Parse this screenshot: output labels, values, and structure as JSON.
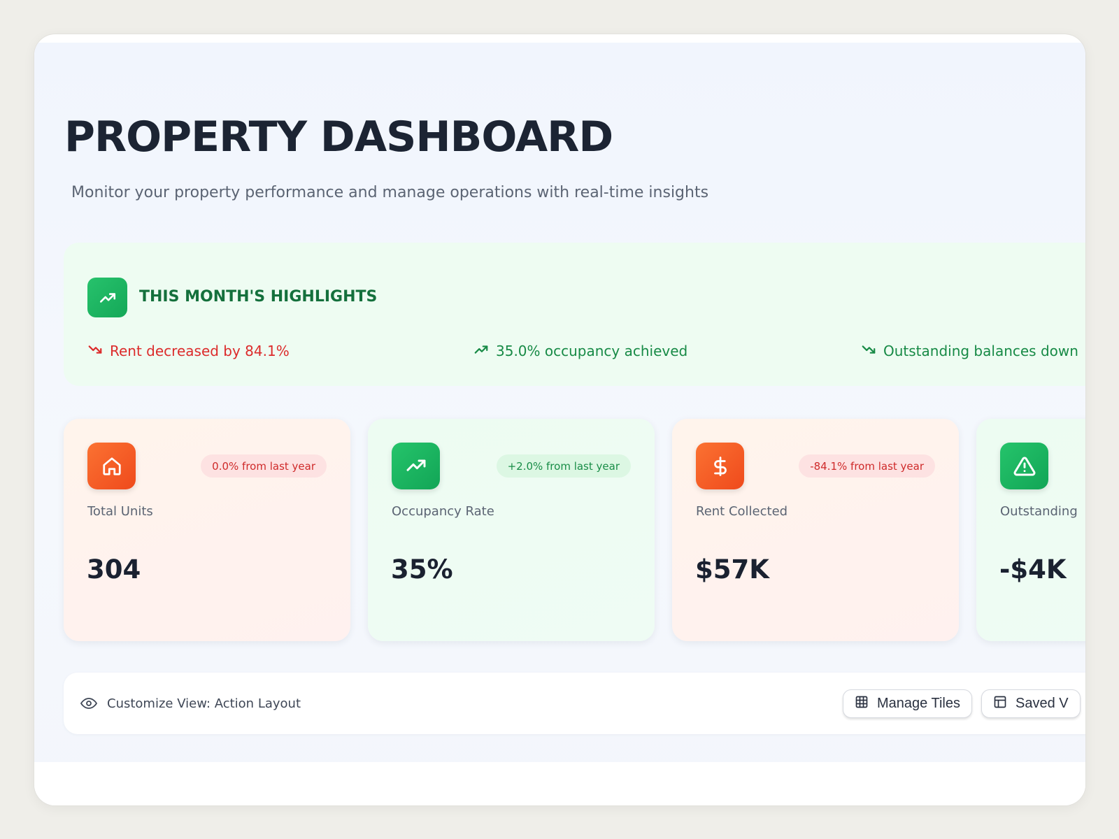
{
  "header": {
    "title": "PROPERTY DASHBOARD",
    "subtitle": "Monitor your property performance and manage operations with real-time insights"
  },
  "highlights": {
    "title": "THIS MONTH'S HIGHLIGHTS",
    "icon": "trending-up-icon",
    "items": [
      {
        "text": "Rent decreased by 84.1%",
        "trend": "down",
        "color": "#dc2b2b"
      },
      {
        "text": "35.0% occupancy achieved",
        "trend": "up",
        "color": "#178a46"
      },
      {
        "text": "Outstanding balances down",
        "trend": "down",
        "color": "#178a46"
      }
    ]
  },
  "stats": [
    {
      "label": "Total Units",
      "value": "304",
      "badge": "0.0% from last year",
      "icon": "home-icon",
      "tone": "negative"
    },
    {
      "label": "Occupancy Rate",
      "value": "35%",
      "badge": "+2.0% from last year",
      "icon": "trending-up-icon",
      "tone": "positive"
    },
    {
      "label": "Rent Collected",
      "value": "$57K",
      "badge": "-84.1% from last year",
      "icon": "dollar-icon",
      "tone": "negative"
    },
    {
      "label": "Outstanding",
      "value": "-$4K",
      "badge": "",
      "icon": "alert-triangle-icon",
      "tone": "positive"
    }
  ],
  "toolbar": {
    "customize_label": "Customize View: Action Layout",
    "manage_tiles_label": "Manage Tiles",
    "saved_views_label": "Saved V"
  },
  "colors": {
    "accent_green": "#16a558",
    "accent_orange": "#f25a22",
    "negative": "#dc2b2b",
    "positive": "#178a46"
  }
}
